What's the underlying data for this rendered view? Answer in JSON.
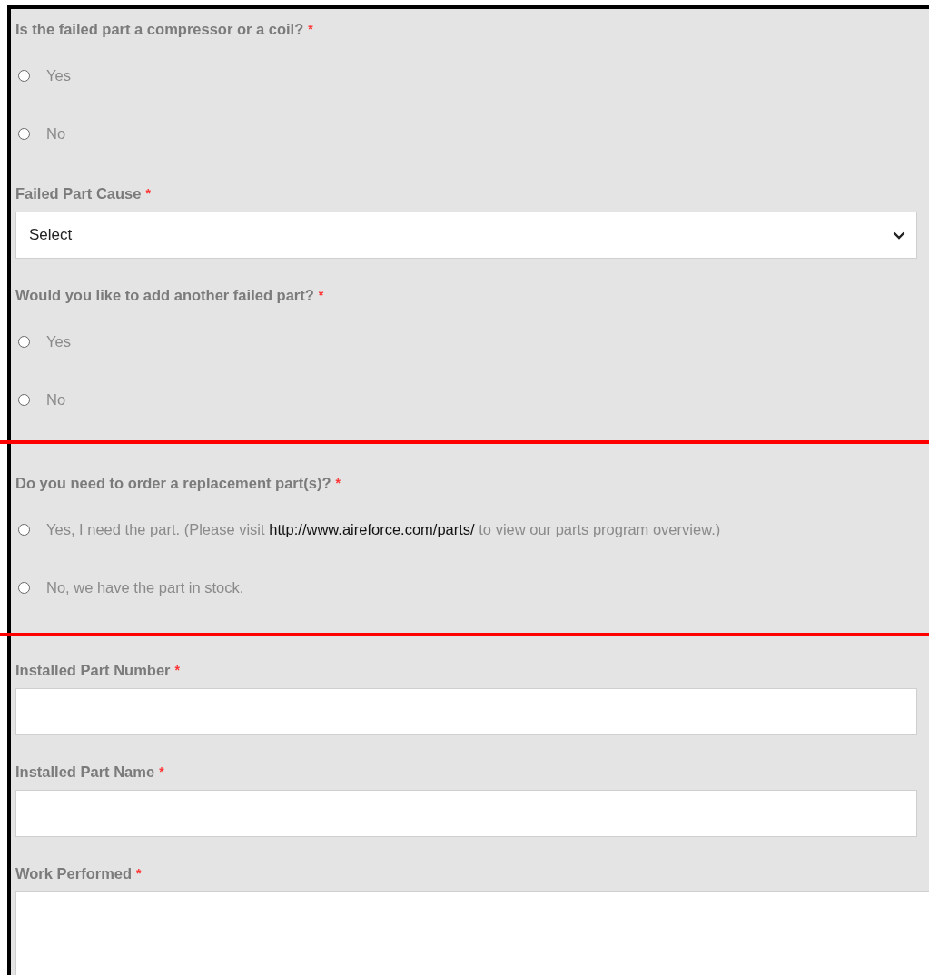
{
  "sections": [
    {
      "fields": [
        {
          "kind": "radio",
          "label": "Is the failed part a compressor or a coil?",
          "required_mark": "*",
          "options": [
            {
              "label": "Yes",
              "selected": false
            },
            {
              "label": "No",
              "selected": false
            }
          ]
        },
        {
          "kind": "select",
          "label": "Failed Part Cause",
          "required_mark": "*",
          "value": "Select"
        },
        {
          "kind": "radio",
          "label": "Would you like to add another failed part?",
          "required_mark": "*",
          "options": [
            {
              "label": "Yes",
              "selected": false
            },
            {
              "label": "No",
              "selected": false
            }
          ]
        }
      ]
    },
    {
      "fields": [
        {
          "kind": "radio",
          "label": "Do you need to order a replacement part(s)?",
          "required_mark": "*",
          "options": [
            {
              "label": "Yes, I need the part. (Please visit ",
              "link": "http://www.aireforce.com/parts/",
              "label_after": " to view our parts program overview.)",
              "selected": false
            },
            {
              "label": "No, we have the part in stock.",
              "selected": false
            }
          ]
        }
      ]
    },
    {
      "fields": [
        {
          "kind": "text",
          "label": "Installed Part Number",
          "required_mark": "*"
        },
        {
          "kind": "text",
          "label": "Installed Part Name",
          "required_mark": "*"
        },
        {
          "kind": "textarea",
          "label": "Work Performed",
          "required_mark": "*"
        }
      ]
    }
  ]
}
